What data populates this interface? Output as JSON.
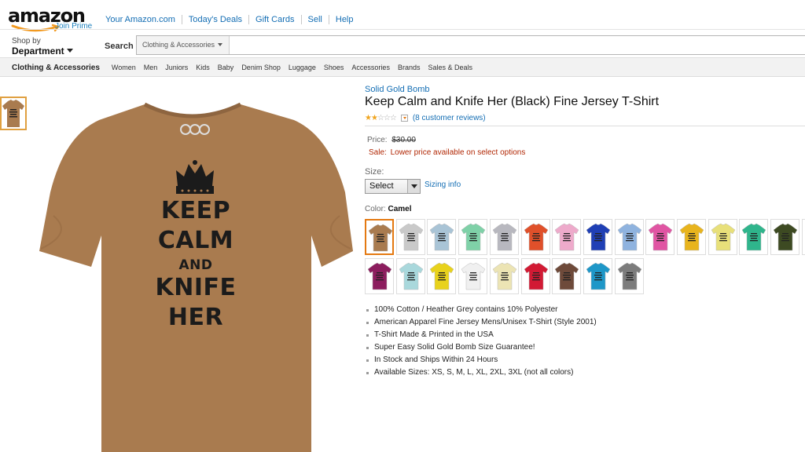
{
  "header": {
    "logo_text": "amazon",
    "join_prime": "Join Prime",
    "nav_links": [
      "Your Amazon.com",
      "Today's Deals",
      "Gift Cards",
      "Sell",
      "Help"
    ],
    "shop_by": "Shop by",
    "department": "Department",
    "search_label": "Search",
    "search_category": "Clothing & Accessories",
    "search_value": ""
  },
  "subnav": {
    "main": "Clothing & Accessories",
    "items": [
      "Women",
      "Men",
      "Juniors",
      "Kids",
      "Baby",
      "Denim Shop",
      "Luggage",
      "Shoes",
      "Accessories",
      "Brands",
      "Sales & Deals"
    ]
  },
  "product_image": {
    "shirt_color": "#a97b4f",
    "print_lines": [
      "KEEP",
      "CALM",
      "AND",
      "KNIFE",
      "HER"
    ],
    "icon": "crown-icon"
  },
  "product": {
    "brand": "Solid Gold Bomb",
    "title": "Keep Calm and Knife Her (Black) Fine Jersey T-Shirt",
    "rating": 1.5,
    "rating_max": 5,
    "reviews_link": "(8 customer reviews)",
    "price_label": "Price:",
    "price_old": "$30.00",
    "sale_label": "Sale:",
    "sale_text": "Lower price available on select options",
    "size_label": "Size:",
    "size_selected": "Select",
    "sizing_info": "Sizing info",
    "color_label": "Color:",
    "color_value": "Camel",
    "swatch_colors": [
      "#a97b4f",
      "#c9c9c9",
      "#a9c4d6",
      "#7fd1a8",
      "#b8b8bf",
      "#e0502a",
      "#eeaacb",
      "#1f3fb5",
      "#8fb3df",
      "#e055a3",
      "#e8b41e",
      "#e8e07a",
      "#2fb58c",
      "#3d4a22",
      "#8a8a8a",
      "#8c1d5e",
      "#a9d8dc",
      "#e8d21c",
      "#f0f0f0",
      "#ece4b4",
      "#d21a34",
      "#6e4a3a",
      "#1e97c8",
      "#7c7c7c"
    ],
    "selected_swatch": 0,
    "features": [
      "100% Cotton / Heather Grey contains 10% Polyester",
      "American Apparel Fine Jersey Mens/Unisex T-Shirt (Style 2001)",
      "T-Shirt Made & Printed in the USA",
      "Super Easy Solid Gold Bomb Size Guarantee!",
      "In Stock and Ships Within 24 Hours",
      "Available Sizes: XS, S, M, L, XL, 2XL, 3XL (not all colors)"
    ]
  }
}
